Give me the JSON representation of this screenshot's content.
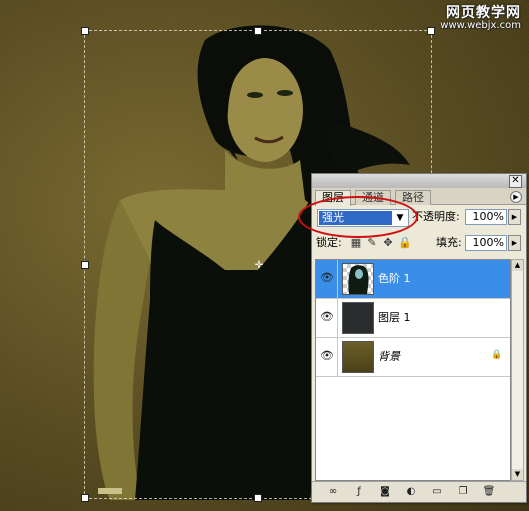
{
  "watermark": {
    "line1": "网页教学网",
    "line2": "www.webjx.com"
  },
  "layers_panel": {
    "tabs": [
      {
        "label": "图层",
        "active": true
      },
      {
        "label": "通道",
        "active": false
      },
      {
        "label": "路径",
        "active": false
      }
    ],
    "close_glyph": "✕",
    "blend_mode": "强光",
    "opacity_label": "不透明度:",
    "opacity_value": "100%",
    "lock_label": "锁定:",
    "fill_label": "填充:",
    "fill_value": "100%",
    "layers": [
      {
        "name": "色阶 1",
        "selected": true,
        "visible": true,
        "thumbnail": "levels-adjustment-mask"
      },
      {
        "name": "图层 1",
        "selected": false,
        "visible": true,
        "thumbnail": "dark-fill"
      },
      {
        "name": "背景",
        "selected": false,
        "visible": true,
        "thumbnail": "olive-background",
        "locked": true
      }
    ],
    "footer_icons": [
      "link-icon",
      "layer-style-icon",
      "mask-icon",
      "adjustment-layer-icon",
      "group-folder-icon",
      "new-layer-icon",
      "trash-icon"
    ]
  },
  "colors": {
    "selection_blue": "#3a8ee8",
    "highlight_blue": "#3169c6",
    "annotation_red": "#d01010",
    "canvas_olive": "#5e5124"
  }
}
